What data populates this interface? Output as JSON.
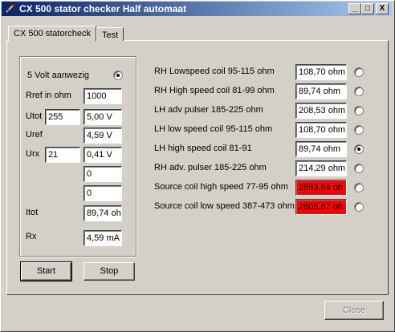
{
  "window": {
    "title": "CX 500 stator checker Half automaat"
  },
  "titlebar_buttons": {
    "minimize": "_",
    "maximize": "□",
    "close": "X"
  },
  "tabs": [
    {
      "label": "CX 500 statorcheck",
      "active": true
    },
    {
      "label": "Test",
      "active": false
    }
  ],
  "left_panel": {
    "five_volt_label": "5 Volt aanwezig",
    "five_volt_checked": true,
    "rref_label": "Rref in ohm",
    "rref_value": "1000",
    "utot_label": "Utot",
    "utot_input": "255",
    "utot_value": "5,00 V",
    "uref_label": "Uref",
    "uref_value": "4,59 V",
    "urx_label": "Urx",
    "urx_input": "21",
    "urx_value": "0,41 V",
    "extra1_value": "0",
    "extra2_value": "0",
    "itot_label": "Itot",
    "itot_value": "89,74 oh",
    "rx_label": "Rx",
    "rx_value": "4,59 mA"
  },
  "buttons": {
    "start": "Start",
    "stop": "Stop",
    "close": "Close"
  },
  "measurements": [
    {
      "label": "RH Lowspeed coil 95-115 ohm",
      "value": "108,70 ohm",
      "error": false,
      "selected": false
    },
    {
      "label": "RH High speed coil 81-99 ohm",
      "value": "89,74 ohm",
      "error": false,
      "selected": false
    },
    {
      "label": "LH adv pulser 185-225 ohm",
      "value": "208,53 ohm",
      "error": false,
      "selected": false
    },
    {
      "label": "LH low speed coil 95-115 ohm",
      "value": "108,70 ohm",
      "error": false,
      "selected": false
    },
    {
      "label": "LH high speed coil 81-91",
      "value": "89,74 ohm",
      "error": false,
      "selected": true
    },
    {
      "label": "RH adv. pulser 185-225 ohm",
      "value": "214,29 ohm",
      "error": false,
      "selected": false
    },
    {
      "label": "Source coil high speed 77-95 ohm",
      "value": "2863,64 oh",
      "error": true,
      "selected": false
    },
    {
      "label": "Source coil low speed 387-473 ohm",
      "value": "2805,67 oh",
      "error": true,
      "selected": false
    }
  ],
  "colors": {
    "title_start": "#0a246a",
    "title_end": "#a6caf0",
    "error_bg": "#ff0000",
    "face": "#d4d0c8"
  }
}
